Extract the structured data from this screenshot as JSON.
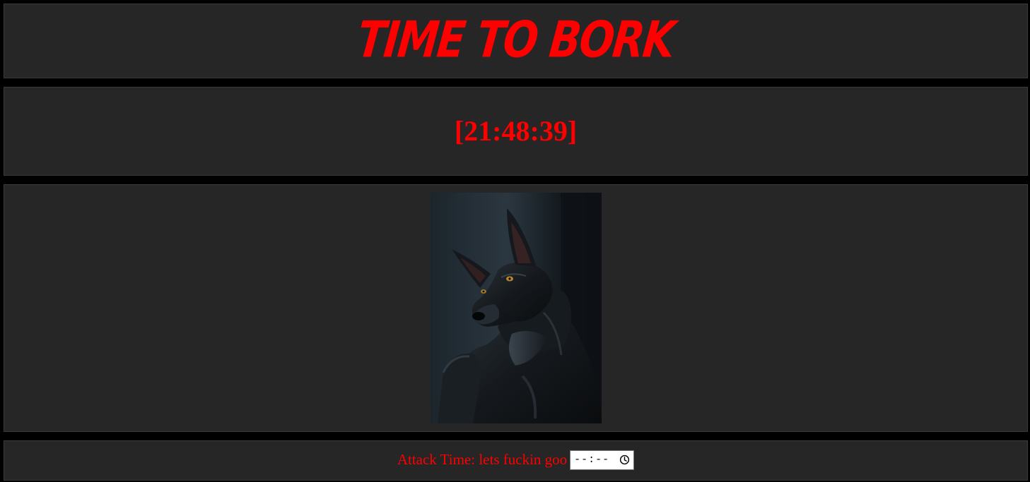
{
  "header": {
    "title": "Time to Bork"
  },
  "clock": {
    "display": "[21:48:39]"
  },
  "image": {
    "subject": "dog-photo"
  },
  "footer": {
    "attack_label": "Attack Time: lets fuckin goo",
    "time_input_value": "",
    "time_input_placeholder": "--:--"
  },
  "colors": {
    "accent": "#ff0000",
    "panel": "#262626",
    "background": "#000000"
  }
}
